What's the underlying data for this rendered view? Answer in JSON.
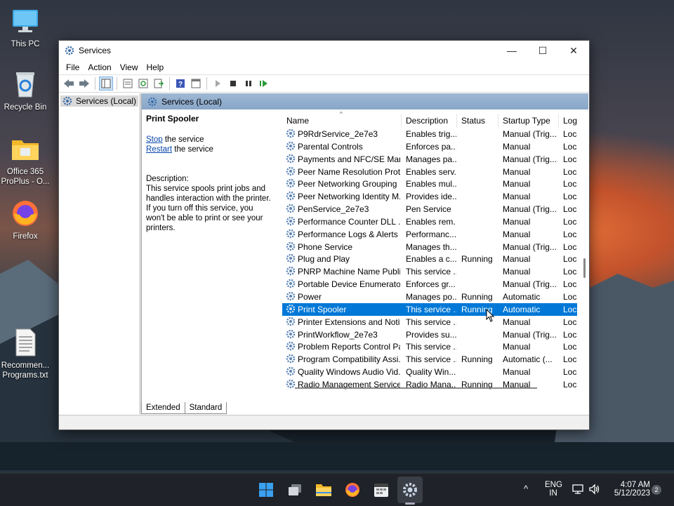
{
  "desktop": {
    "icons": [
      {
        "label": "This PC",
        "icon": "monitor-icon"
      },
      {
        "label": "Recycle Bin",
        "icon": "recycle-bin-icon"
      },
      {
        "label_line1": "Office 365",
        "label_line2": "ProPlus - O...",
        "icon": "folder-icon"
      },
      {
        "label": "Firefox",
        "icon": "firefox-icon"
      },
      {
        "label_line1": "Recommen...",
        "label_line2": "Programs.txt",
        "icon": "text-file-icon"
      }
    ]
  },
  "window": {
    "title": "Services",
    "controls": {
      "minimize": "—",
      "maximize": "☐",
      "close": "✕"
    },
    "menu": [
      "File",
      "Action",
      "View",
      "Help"
    ],
    "toolbar_icons": [
      "back-icon",
      "forward-icon",
      "show-hide-console-tree-icon",
      "properties-icon",
      "refresh-icon",
      "export-list-icon",
      "help-icon",
      "console-icon",
      "start-service-icon",
      "stop-service-icon",
      "pause-service-icon",
      "restart-service-icon"
    ],
    "tree": {
      "item": "Services (Local)"
    },
    "pane_header": "Services (Local)",
    "detail": {
      "service_name": "Print Spooler",
      "stop_link": "Stop",
      "stop_rest": " the service",
      "restart_link": "Restart",
      "restart_rest": " the service",
      "description_label": "Description:",
      "description_text": "This service spools print jobs and handles interaction with the printer. If you turn off this service, you won't be able to print or see your printers."
    },
    "columns": [
      "Name",
      "Description",
      "Status",
      "Startup Type",
      "Log"
    ],
    "sort_indicator": "^",
    "rows": [
      {
        "name": "P9RdrService_2e7e3",
        "desc": "Enables trig...",
        "status": "",
        "startup": "Manual (Trig...",
        "log": "Loca"
      },
      {
        "name": "Parental Controls",
        "desc": "Enforces pa...",
        "status": "",
        "startup": "Manual",
        "log": "Loca"
      },
      {
        "name": "Payments and NFC/SE Man...",
        "desc": "Manages pa...",
        "status": "",
        "startup": "Manual (Trig...",
        "log": "Loca"
      },
      {
        "name": "Peer Name Resolution Prot...",
        "desc": "Enables serv...",
        "status": "",
        "startup": "Manual",
        "log": "Loca"
      },
      {
        "name": "Peer Networking Grouping",
        "desc": "Enables mul...",
        "status": "",
        "startup": "Manual",
        "log": "Loca"
      },
      {
        "name": "Peer Networking Identity M...",
        "desc": "Provides ide...",
        "status": "",
        "startup": "Manual",
        "log": "Loca"
      },
      {
        "name": "PenService_2e7e3",
        "desc": "Pen Service",
        "status": "",
        "startup": "Manual (Trig...",
        "log": "Loca"
      },
      {
        "name": "Performance Counter DLL ...",
        "desc": "Enables rem...",
        "status": "",
        "startup": "Manual",
        "log": "Loca"
      },
      {
        "name": "Performance Logs & Alerts",
        "desc": "Performanc...",
        "status": "",
        "startup": "Manual",
        "log": "Loca"
      },
      {
        "name": "Phone Service",
        "desc": "Manages th...",
        "status": "",
        "startup": "Manual (Trig...",
        "log": "Loca"
      },
      {
        "name": "Plug and Play",
        "desc": "Enables a c...",
        "status": "Running",
        "startup": "Manual",
        "log": "Loca"
      },
      {
        "name": "PNRP Machine Name Publi...",
        "desc": "This service ...",
        "status": "",
        "startup": "Manual",
        "log": "Loca"
      },
      {
        "name": "Portable Device Enumerator...",
        "desc": "Enforces gr...",
        "status": "",
        "startup": "Manual (Trig...",
        "log": "Loca"
      },
      {
        "name": "Power",
        "desc": "Manages po...",
        "status": "Running",
        "startup": "Automatic",
        "log": "Loca"
      },
      {
        "name": "Print Spooler",
        "desc": "This service ...",
        "status": "Running",
        "startup": "Automatic",
        "log": "Loca",
        "selected": true
      },
      {
        "name": "Printer Extensions and Notif...",
        "desc": "This service ...",
        "status": "",
        "startup": "Manual",
        "log": "Loca"
      },
      {
        "name": "PrintWorkflow_2e7e3",
        "desc": "Provides su...",
        "status": "",
        "startup": "Manual (Trig...",
        "log": "Loca"
      },
      {
        "name": "Problem Reports Control Pa...",
        "desc": "This service ...",
        "status": "",
        "startup": "Manual",
        "log": "Loca"
      },
      {
        "name": "Program Compatibility Assi...",
        "desc": "This service ...",
        "status": "Running",
        "startup": "Automatic (...",
        "log": "Loca"
      },
      {
        "name": "Quality Windows Audio Vid...",
        "desc": "Quality Win...",
        "status": "",
        "startup": "Manual",
        "log": "Loca"
      },
      {
        "name": "Radio Management Service",
        "desc": "Radio Mana...",
        "status": "Running",
        "startup": "Manual",
        "log": "Loca"
      }
    ],
    "tabs": [
      "Extended",
      "Standard"
    ],
    "active_tab": "Extended"
  },
  "taskbar": {
    "apps": [
      "start-icon",
      "task-view-icon",
      "file-explorer-icon",
      "firefox-icon",
      "calendar-app-icon",
      "services-gear-icon"
    ],
    "tray": {
      "chevron": "^",
      "lang_line1": "ENG",
      "lang_line2": "IN",
      "time": "4:07 AM",
      "date": "5/12/2023",
      "notifications": "2"
    }
  },
  "colors": {
    "selection": "#0078d7",
    "pane_header": "#9fb8d4",
    "taskbar": "#1f2228",
    "link": "#0645ad"
  }
}
